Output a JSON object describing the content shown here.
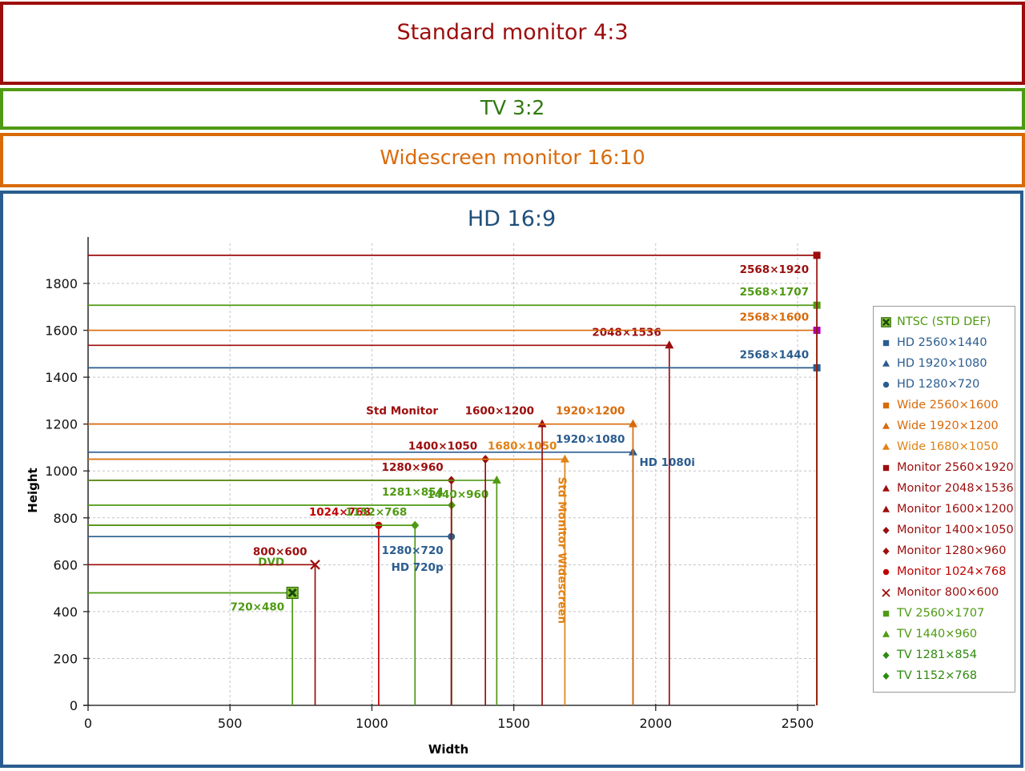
{
  "bands": [
    {
      "id": "standard-monitor-4-3",
      "title": "Standard monitor 4:3",
      "color": "#9c0d0d"
    },
    {
      "id": "tv-3-2",
      "title": "TV 3:2",
      "color": "#2f7a10"
    },
    {
      "id": "widescreen-monitor-16-10",
      "title": "Widescreen monitor 16:10",
      "color": "#d96a0a"
    },
    {
      "id": "hd-16-9",
      "title": "HD 16:9",
      "color": "#1f4e79"
    }
  ],
  "chart_data": {
    "type": "scatter",
    "title": "HD 16:9",
    "xlabel": "Width",
    "ylabel": "Height",
    "xlim": [
      0,
      2620
    ],
    "ylim": [
      0,
      1960
    ],
    "xticks": [
      0,
      500,
      1000,
      1500,
      2000,
      2500
    ],
    "yticks": [
      0,
      200,
      400,
      600,
      800,
      1000,
      1200,
      1400,
      1600,
      1800
    ],
    "grid": true,
    "legend_position": "right",
    "points": [
      {
        "name": "NTSC (STD DEF)",
        "x": 720,
        "y": 480,
        "color": "#4f9a13",
        "marker": "xbox",
        "label": "720×480",
        "label_pos": "below-left",
        "extra_label": "DVD",
        "extra_pos": "above-left"
      },
      {
        "name": "Monitor 800×600",
        "x": 800,
        "y": 600,
        "color": "#9c0d0d",
        "marker": "cross",
        "label": "800×600",
        "label_pos": "above-left"
      },
      {
        "name": "Monitor 1024×768",
        "x": 1024,
        "y": 768,
        "color": "#c00000",
        "marker": "circle",
        "label": "1024×768",
        "label_pos": "above-left"
      },
      {
        "name": "TV 1152×768",
        "x": 1152,
        "y": 768,
        "color": "#4f9a13",
        "marker": "diamond",
        "label": "1152×768",
        "label_pos": "above-left"
      },
      {
        "name": "HD 1280×720",
        "x": 1280,
        "y": 720,
        "color": "#2a5c8f",
        "marker": "circle",
        "label": "1280×720",
        "label_pos": "below-left",
        "extra_label": "HD 720p",
        "extra_pos": "below2-left"
      },
      {
        "name": "TV 1281×854",
        "x": 1281,
        "y": 854,
        "color": "#4f9a13",
        "marker": "diamond",
        "label": "1281×854",
        "label_pos": "above-left"
      },
      {
        "name": "Monitor 1280×960",
        "x": 1280,
        "y": 960,
        "color": "#9c0d0d",
        "marker": "diamond",
        "label": "1280×960",
        "label_pos": "above-left"
      },
      {
        "name": "TV 1440×960",
        "x": 1440,
        "y": 960,
        "color": "#4f9a13",
        "marker": "triangle",
        "label": "1440×960",
        "label_pos": "below-left"
      },
      {
        "name": "Monitor 1400×1050",
        "x": 1400,
        "y": 1050,
        "color": "#9c0d0d",
        "marker": "diamond",
        "label": "1400×1050",
        "label_pos": "above-left"
      },
      {
        "name": "Wide 1680×1050",
        "x": 1680,
        "y": 1050,
        "color": "#e08214",
        "marker": "triangle",
        "label": "1680×1050",
        "label_pos": "above-left",
        "extra_label": "Std Monitor Widescreen",
        "extra_pos": "rotated"
      },
      {
        "name": "HD 1920×1080",
        "x": 1920,
        "y": 1080,
        "color": "#2a5c8f",
        "marker": "triangle",
        "label": "1920×1080",
        "label_pos": "above-left",
        "extra_label": "HD 1080i",
        "extra_pos": "below-left"
      },
      {
        "name": "Monitor 1600×1200",
        "x": 1600,
        "y": 1200,
        "color": "#9c0d0d",
        "marker": "triangle",
        "label": "1600×1200",
        "label_pos": "above-left",
        "extra_label": "Std Monitor",
        "extra_pos": "above-far-left"
      },
      {
        "name": "Wide 1920×1200",
        "x": 1920,
        "y": 1200,
        "color": "#d96a0a",
        "marker": "triangle",
        "label": "1920×1200",
        "label_pos": "above-left"
      },
      {
        "name": "Monitor 2048×1536",
        "x": 2048,
        "y": 1536,
        "color": "#9c0d0d",
        "marker": "triangle",
        "label": "2048×1536",
        "label_pos": "above-left"
      },
      {
        "name": "HD 2560×1440",
        "x": 2568,
        "y": 1440,
        "color": "#2a5c8f",
        "marker": "square",
        "label": "2568×1440",
        "label_pos": "above-left"
      },
      {
        "name": "Wide 2560×1600",
        "x": 2568,
        "y": 1600,
        "color": "#d96a0a",
        "marker": "square-magenta",
        "label": "2568×1600",
        "label_pos": "above-left"
      },
      {
        "name": "TV 2560×1707",
        "x": 2568,
        "y": 1707,
        "color": "#4f9a13",
        "marker": "square",
        "label": "2568×1707",
        "label_pos": "above-left"
      },
      {
        "name": "Monitor 2560×1920",
        "x": 2568,
        "y": 1920,
        "color": "#9c0d0d",
        "marker": "square",
        "label": "2568×1920",
        "label_pos": "below-left"
      }
    ],
    "legend_entries": [
      {
        "label": "NTSC (STD DEF)",
        "color": "#4f9a13",
        "marker": "xbox"
      },
      {
        "label": "HD 2560×1440",
        "color": "#2a5c8f",
        "marker": "square"
      },
      {
        "label": "HD 1920×1080",
        "color": "#2a5c8f",
        "marker": "triangle"
      },
      {
        "label": "HD 1280×720",
        "color": "#2a5c8f",
        "marker": "circle"
      },
      {
        "label": "Wide 2560×1600",
        "color": "#d96a0a",
        "marker": "square"
      },
      {
        "label": "Wide 1920×1200",
        "color": "#d96a0a",
        "marker": "triangle"
      },
      {
        "label": "Wide 1680×1050",
        "color": "#e08214",
        "marker": "triangle"
      },
      {
        "label": "Monitor 2560×1920",
        "color": "#9c0d0d",
        "marker": "square"
      },
      {
        "label": "Monitor 2048×1536",
        "color": "#9c0d0d",
        "marker": "triangle"
      },
      {
        "label": "Monitor 1600×1200",
        "color": "#9c0d0d",
        "marker": "triangle"
      },
      {
        "label": "Monitor 1400×1050",
        "color": "#9c0d0d",
        "marker": "diamond"
      },
      {
        "label": "Monitor 1280×960",
        "color": "#9c0d0d",
        "marker": "diamond"
      },
      {
        "label": "Monitor 1024×768",
        "color": "#c00000",
        "marker": "circle"
      },
      {
        "label": "Monitor 800×600",
        "color": "#9c0d0d",
        "marker": "cross"
      },
      {
        "label": "TV 2560×1707",
        "color": "#4f9a13",
        "marker": "square"
      },
      {
        "label": "TV 1440×960",
        "color": "#4f9a13",
        "marker": "triangle"
      },
      {
        "label": "TV 1281×854",
        "color": "#2f8a10",
        "marker": "diamond"
      },
      {
        "label": "TV 1152×768",
        "color": "#2f8a10",
        "marker": "diamond"
      }
    ]
  }
}
